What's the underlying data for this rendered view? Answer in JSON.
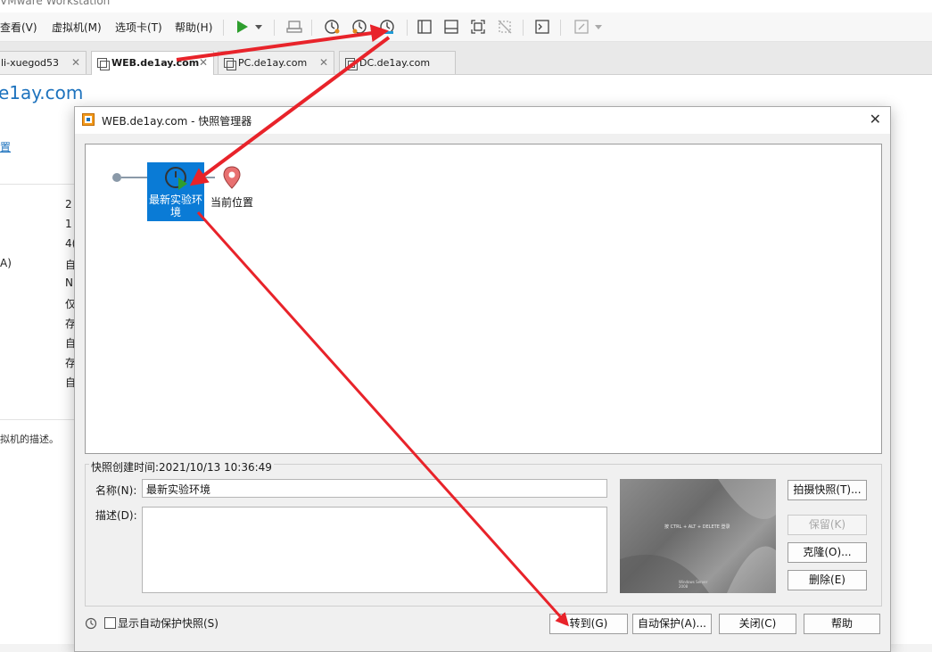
{
  "window": {
    "title": "VMware Workstation"
  },
  "menu": [
    "查看(V)",
    "虚拟机(M)",
    "选项卡(T)",
    "帮助(H)"
  ],
  "tabs": [
    {
      "label": "li-xuegod53",
      "active": false
    },
    {
      "label": "WEB.de1ay.com",
      "active": true
    },
    {
      "label": "PC.de1ay.com",
      "active": false
    },
    {
      "label": "DC.de1ay.com",
      "active": false
    }
  ],
  "vm": {
    "name": "e1ay.com",
    "edit_link": "置",
    "devices_left": [
      "A)"
    ],
    "devices": [
      "2",
      "1",
      "4(",
      "自",
      "N",
      "仅",
      "存",
      "自",
      "存",
      "自"
    ],
    "description": "拟机的描述。"
  },
  "dialog": {
    "title": "WEB.de1ay.com - 快照管理器",
    "snapshot": {
      "name": "最新实验环境",
      "current_label": "当前位置"
    },
    "created_label": "快照创建时间:2021/10/13 10:36:49",
    "name_label": "名称(N):",
    "name_value": "最新实验环境",
    "desc_label": "描述(D):",
    "thumbnail_text": "按 CTRL + ALT + DELETE 登录",
    "thumbnail_brand": "Windows Server 2008",
    "buttons": {
      "take": "拍摄快照(T)...",
      "keep": "保留(K)",
      "clone": "克隆(O)...",
      "delete": "删除(E)",
      "goto": "转到(G)",
      "autoprotect": "自动保护(A)...",
      "close": "关闭(C)",
      "help": "帮助"
    },
    "show_autoprotect": "显示自动保护快照(S)"
  },
  "colors": {
    "accent": "#0a7bd6",
    "link": "#1e73be",
    "arrow": "#e8232a",
    "play": "#2e9e2e"
  }
}
